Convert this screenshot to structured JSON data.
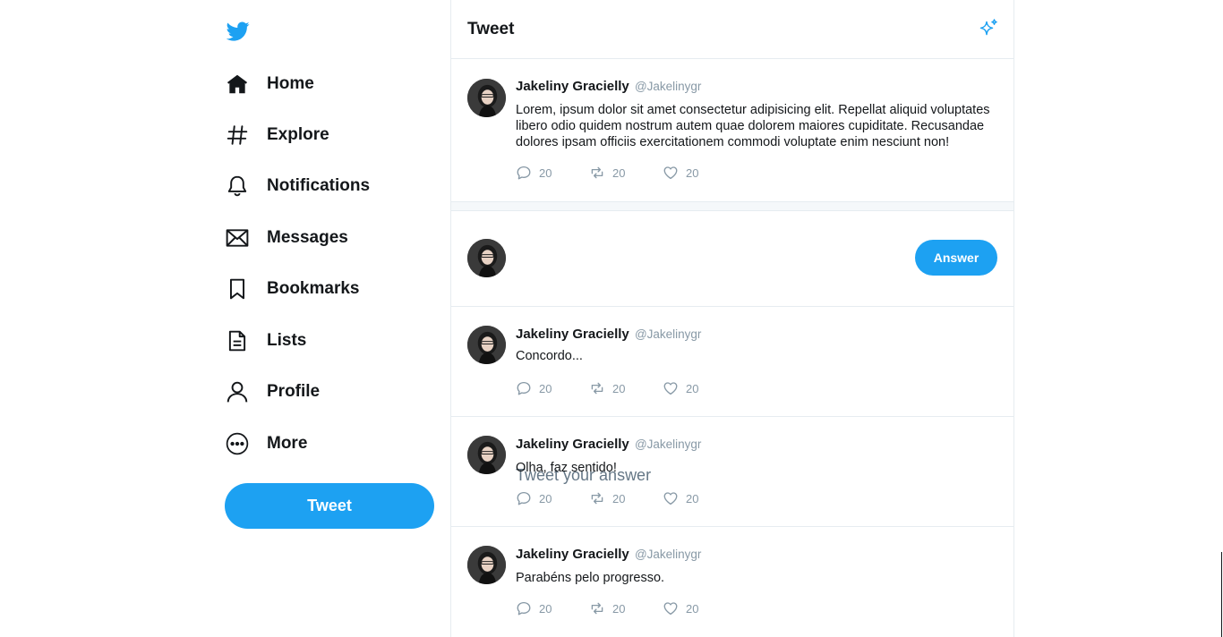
{
  "nav": {
    "items": [
      {
        "label": "Home",
        "icon": "home-icon"
      },
      {
        "label": "Explore",
        "icon": "hashtag-icon"
      },
      {
        "label": "Notifications",
        "icon": "bell-icon"
      },
      {
        "label": "Messages",
        "icon": "envelope-icon"
      },
      {
        "label": "Bookmarks",
        "icon": "bookmark-icon"
      },
      {
        "label": "Lists",
        "icon": "list-document-icon"
      },
      {
        "label": "Profile",
        "icon": "person-icon"
      },
      {
        "label": "More",
        "icon": "more-circle-icon"
      }
    ],
    "tweet_button": "Tweet"
  },
  "header": {
    "title": "Tweet",
    "icon": "sparkle-icon"
  },
  "main_tweet": {
    "author": "Jakeliny Gracielly",
    "handle": "@Jakelinygr",
    "text": "Lorem, ipsum dolor sit amet consectetur adipisicing elit. Repellat aliquid voluptates libero odio quidem nostrum autem quae dolorem maiores cupiditate. Recusandae dolores ipsam officiis exercitationem commodi voluptate enim nesciunt non!",
    "replies": "20",
    "retweets": "20",
    "likes": "20"
  },
  "composer": {
    "placeholder": "Tweet your answer",
    "button": "Answer"
  },
  "replies": [
    {
      "author": "Jakeliny Gracielly",
      "handle": "@Jakelinygr",
      "text": "Concordo...",
      "replies": "20",
      "retweets": "20",
      "likes": "20"
    },
    {
      "author": "Jakeliny Gracielly",
      "handle": "@Jakelinygr",
      "text": "Olha, faz sentido!",
      "replies": "20",
      "retweets": "20",
      "likes": "20"
    },
    {
      "author": "Jakeliny Gracielly",
      "handle": "@Jakelinygr",
      "text": "Parabéns pelo progresso.",
      "replies": "20",
      "retweets": "20",
      "likes": "20"
    }
  ],
  "colors": {
    "accent": "#1da1f2",
    "muted": "#8899a6",
    "border": "#e6ecf0"
  }
}
